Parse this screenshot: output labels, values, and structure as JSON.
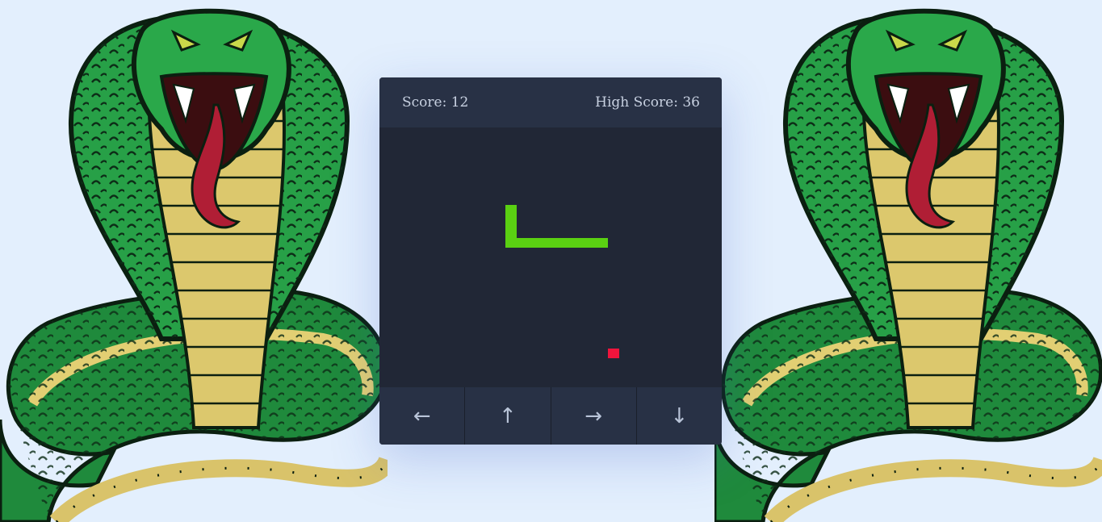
{
  "header": {
    "score_label": "Score: 12",
    "high_score_label": "High Score: 36"
  },
  "board": {
    "snake_color": "#5ad012",
    "food_color": "#f0143c",
    "background": "#212736"
  },
  "controls": [
    {
      "label": "←",
      "icon": "arrow-left-icon"
    },
    {
      "label": "↑",
      "icon": "arrow-up-icon"
    },
    {
      "label": "→",
      "icon": "arrow-right-icon"
    },
    {
      "label": "↓",
      "icon": "arrow-down-icon"
    }
  ],
  "decor": {
    "left_image": "cobra-illustration",
    "right_image": "cobra-illustration"
  }
}
